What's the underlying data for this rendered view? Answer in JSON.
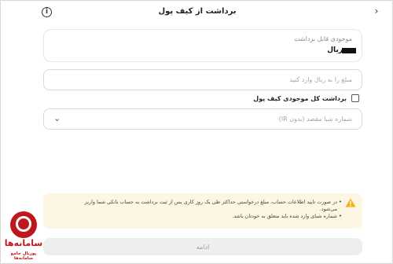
{
  "header": {
    "title": "برداشت از کیف پول",
    "back_icon": "chevron-right-icon",
    "info_icon": "info-icon",
    "info_glyph": "i",
    "back_glyph": "›"
  },
  "balance": {
    "label": "موجودی قابل برداشت",
    "currency": "ریال"
  },
  "amount": {
    "placeholder": "مبلغ را به ریال وارد کنید",
    "value": ""
  },
  "withdraw_all": {
    "label": "برداشت کل موجودی کیف پول",
    "checked": false
  },
  "iban": {
    "placeholder": "شماره شبا مقصد (بدون IR)",
    "chevron_icon": "chevron-down-icon",
    "chevron_glyph": "⌄"
  },
  "warning": {
    "icon": "warning-triangle-icon",
    "bg_color": "#fdf6e3",
    "icon_color": "#f2b01e",
    "items": [
      "در صورت تایید اطلاعات حساب، مبلغ درخواستی حداکثر طی یک روز کاری پس از ثبت برداشت به حساب بانکی شما واریز می‌شود.",
      "شماره شبای وارد شده باید متعلق به خودتان باشد."
    ]
  },
  "continue_label": "ادامه",
  "watermark": {
    "brand": "سامانه‌ها",
    "tagline": "پورتال جامع سامانه‌ها",
    "color": "#c0171e"
  }
}
